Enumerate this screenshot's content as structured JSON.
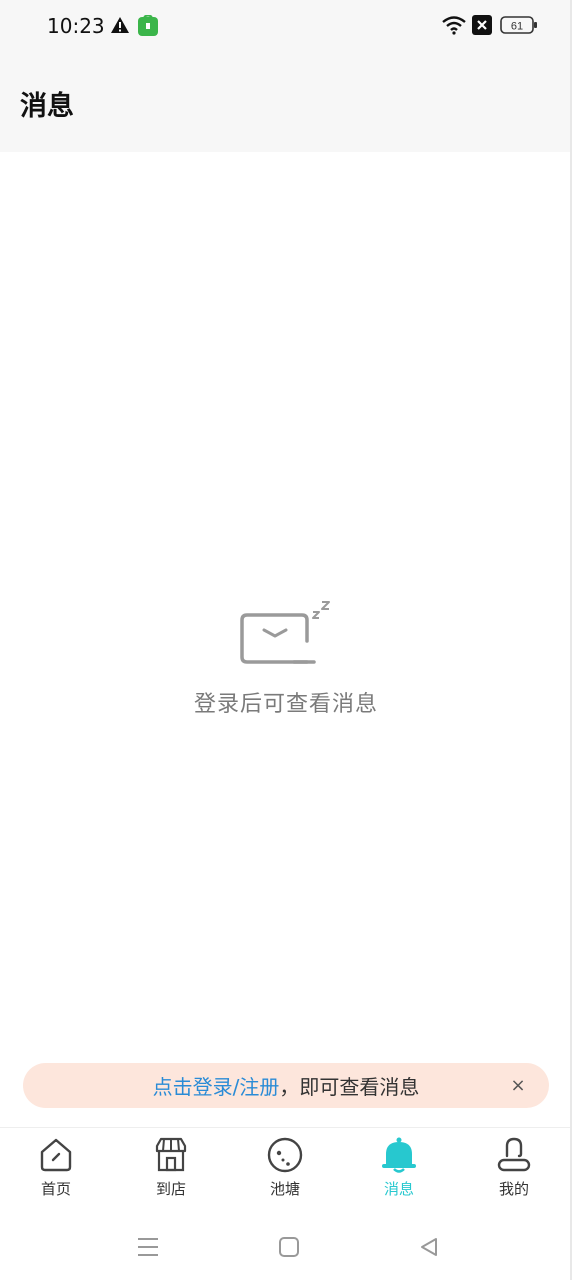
{
  "status_bar": {
    "time": "10:23",
    "battery": "61"
  },
  "header": {
    "title": "消息"
  },
  "empty_state": {
    "icon": "sleeping-mail-icon",
    "message": "登录后可查看消息"
  },
  "login_banner": {
    "link_text": "点击登录/注册",
    "text": "，即可查看消息",
    "close_label": "×"
  },
  "tab_bar": {
    "active_color": "#27c8cf",
    "items": [
      {
        "label": "首页",
        "icon": "home-icon"
      },
      {
        "label": "到店",
        "icon": "store-icon"
      },
      {
        "label": "池塘",
        "icon": "pond-icon"
      },
      {
        "label": "消息",
        "icon": "bell-icon",
        "active": true
      },
      {
        "label": "我的",
        "icon": "profile-icon"
      }
    ]
  },
  "system_nav": {
    "items": [
      "menu-icon",
      "home-square-icon",
      "back-triangle-icon"
    ]
  }
}
